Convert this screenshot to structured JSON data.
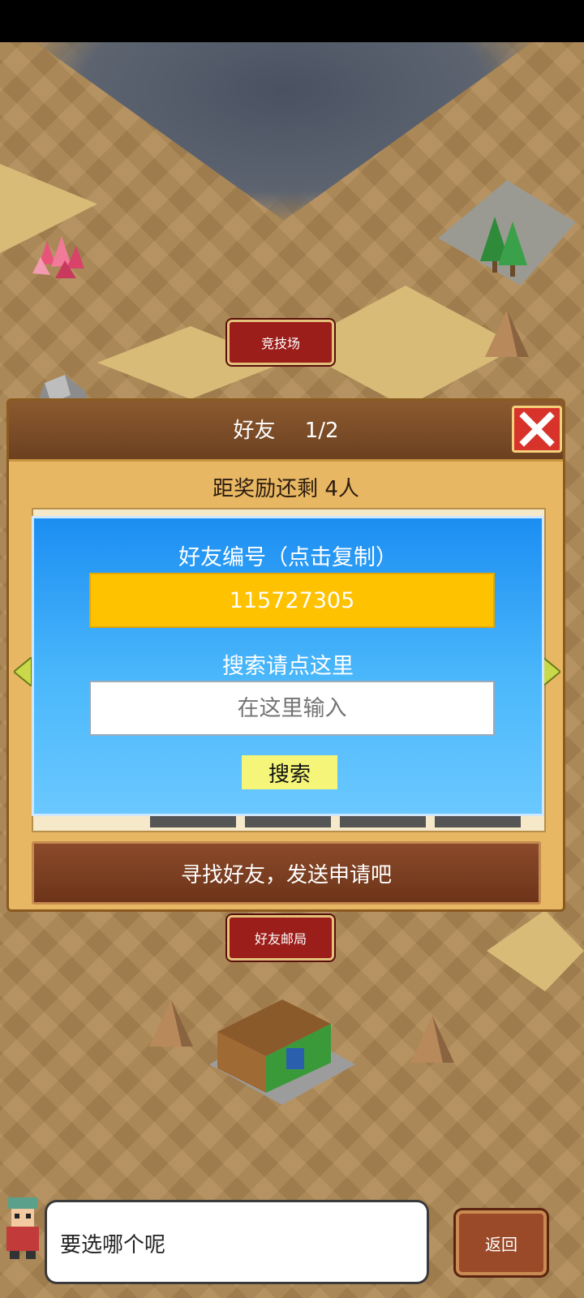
{
  "map": {
    "arena_label": "竞技场",
    "post_office_label": "好友邮局"
  },
  "dialog": {
    "title": "好友",
    "page": "1/2",
    "reward_text": "距奖励还剩 4人",
    "friend_id_label": "好友编号（点击复制）",
    "friend_id": "115727305",
    "search_label": "搜索请点这里",
    "search_placeholder": "在这里输入",
    "search_button": "搜索",
    "find_friends_button": "寻找好友，发送申请吧"
  },
  "footer": {
    "speech": "要选哪个呢",
    "back_button": "返回"
  },
  "colors": {
    "id_box": "#ffc200",
    "close_button": "#d8332b",
    "panel_blue": "#1c8ef2",
    "label_red": "#9b1e1a"
  }
}
